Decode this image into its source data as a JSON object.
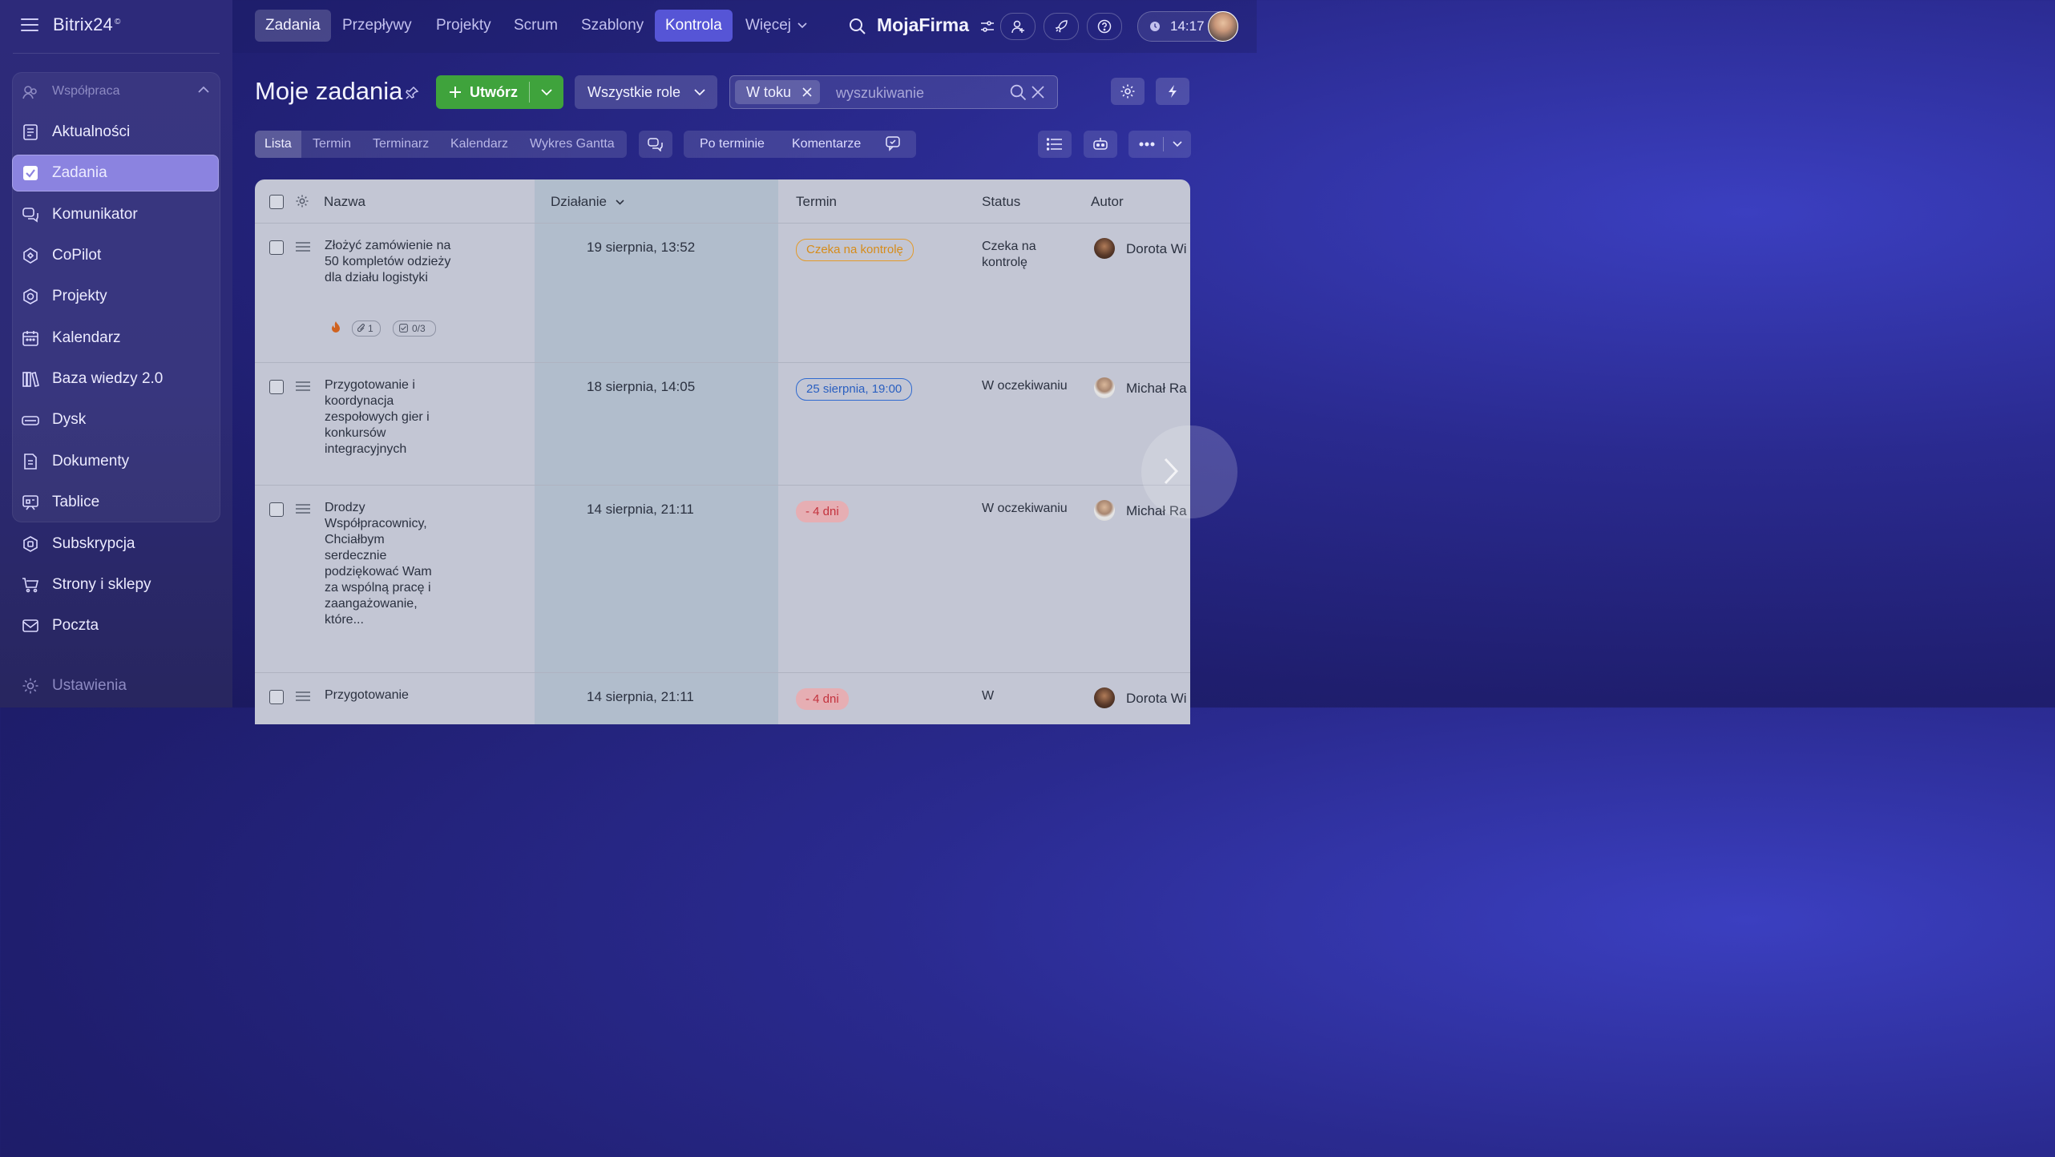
{
  "app": {
    "logo": "Bitrix24",
    "logo_mark": "©",
    "company": "MojaFirma",
    "time": "14:17"
  },
  "sidebar": {
    "group_label": "Współpraca",
    "items": [
      {
        "label": "Aktualności",
        "icon": "newspaper-icon"
      },
      {
        "label": "Zadania",
        "icon": "checkbox-icon",
        "active": true
      },
      {
        "label": "Komunikator",
        "icon": "chat-icon"
      },
      {
        "label": "CoPilot",
        "icon": "copilot-icon"
      },
      {
        "label": "Projekty",
        "icon": "projects-icon"
      },
      {
        "label": "Kalendarz",
        "icon": "calendar-icon"
      },
      {
        "label": "Baza wiedzy 2.0",
        "icon": "books-icon"
      },
      {
        "label": "Dysk",
        "icon": "drive-icon"
      },
      {
        "label": "Dokumenty",
        "icon": "document-icon"
      },
      {
        "label": "Tablice",
        "icon": "board-icon"
      },
      {
        "label": "Subskrypcja",
        "icon": "subscription-icon"
      },
      {
        "label": "Strony i sklepy",
        "icon": "cart-icon"
      },
      {
        "label": "Poczta",
        "icon": "mail-icon"
      }
    ],
    "settings_label": "Ustawienia"
  },
  "topnav": {
    "tabs": [
      "Zadania",
      "Przepływy",
      "Projekty",
      "Scrum",
      "Szablony",
      "Kontrola",
      "Więcej"
    ]
  },
  "header": {
    "title": "Moje zadania",
    "create_label": "Utwórz",
    "roles_label": "Wszystkie role",
    "filter_chip": "W toku",
    "search_placeholder": "wyszukiwanie"
  },
  "views": {
    "tabs": [
      "Lista",
      "Termin",
      "Terminarz",
      "Kalendarz",
      "Wykres Gantta"
    ],
    "filters": [
      "Po terminie",
      "Komentarze"
    ]
  },
  "table": {
    "columns": [
      "Nazwa",
      "Działanie",
      "Termin",
      "Status",
      "Autor"
    ],
    "rows": [
      {
        "name": "Złożyć zamówienie na 50 kompletów odzieży dla działu logistyki",
        "activity": "19 sierpnia, 13:52",
        "deadline": "Czeka na kontrolę",
        "status": "Czeka na kontrolę",
        "author": "Dorota Wi",
        "attachments": "1",
        "checklist": "0/3"
      },
      {
        "name": "Przygotowanie i koordynacja zespołowych gier i konkursów integracyjnych",
        "activity": "18 sierpnia, 14:05",
        "deadline": "25 sierpnia, 19:00",
        "status": "W oczekiwaniu",
        "author": "Michał Ra"
      },
      {
        "name": "Drodzy Współpracownicy, Chciałbym serdecznie podziękować Wam za wspólną pracę i zaangażowanie, które...",
        "activity": "14 sierpnia, 21:11",
        "deadline": "- 4 dni",
        "status": "W oczekiwaniu",
        "author": "Michał Ra"
      },
      {
        "name": "Przygotowanie",
        "activity": "14 sierpnia, 21:11",
        "deadline": "- 4 dni",
        "status": "W",
        "author": "Dorota Wi"
      }
    ]
  }
}
